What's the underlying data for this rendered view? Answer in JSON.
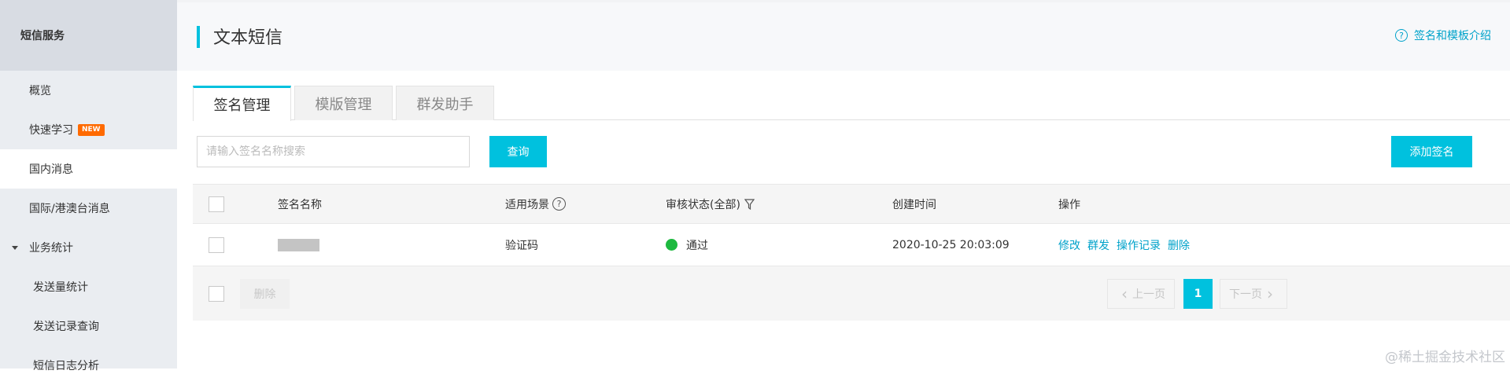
{
  "sidebar": {
    "header": "短信服务",
    "items": [
      {
        "label": "概览"
      },
      {
        "label": "快速学习",
        "badge": "NEW"
      },
      {
        "label": "国内消息"
      },
      {
        "label": "国际/港澳台消息"
      },
      {
        "label": "业务统计"
      },
      {
        "label": "发送量统计"
      },
      {
        "label": "发送记录查询"
      },
      {
        "label": "短信日志分析"
      }
    ]
  },
  "header": {
    "title": "文本短信",
    "help_link": "签名和模板介绍"
  },
  "tabs": [
    {
      "label": "签名管理",
      "active": true
    },
    {
      "label": "模版管理",
      "active": false
    },
    {
      "label": "群发助手",
      "active": false
    }
  ],
  "search": {
    "placeholder": "请输入签名名称搜索",
    "value": "",
    "query_button": "查询"
  },
  "add_button": "添加签名",
  "table": {
    "columns": [
      "签名名称",
      "适用场景",
      "审核状态(全部)",
      "创建时间",
      "操作"
    ],
    "rows": [
      {
        "scene": "验证码",
        "status": "通过",
        "created": "2020-10-25 20:03:09",
        "ops": [
          "修改",
          "群发",
          "操作记录",
          "删除"
        ]
      }
    ]
  },
  "footer": {
    "delete_button": "删除",
    "prev": "上一页",
    "page": "1",
    "next": "下一页"
  },
  "watermark": "@稀土掘金技术社区",
  "colors": {
    "accent": "#00c1de",
    "link": "#00a2ca",
    "brand_orange": "#ff6a00",
    "status_green": "#1db93f"
  }
}
